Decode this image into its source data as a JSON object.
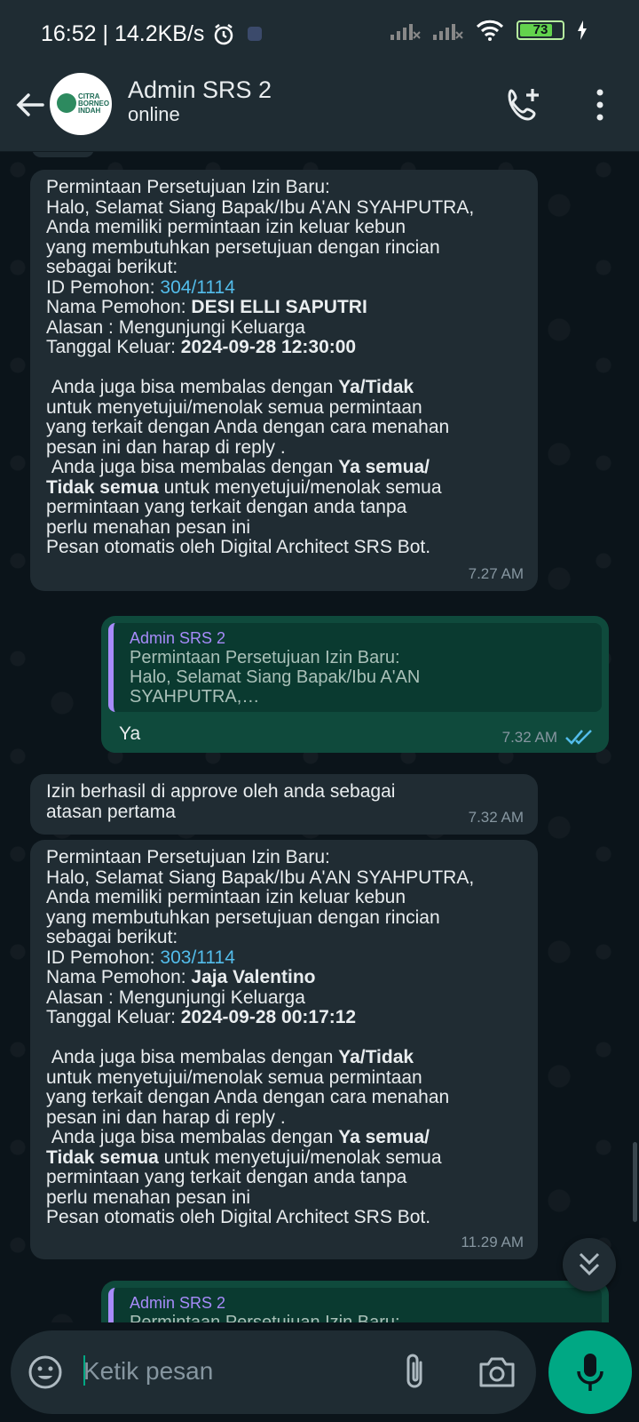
{
  "status_bar": {
    "time_speed": "16:52 | 14.2KB/s",
    "battery": "73"
  },
  "header": {
    "contact_name": "Admin SRS 2",
    "contact_status": "online",
    "avatar_text": [
      "CITRA",
      "BORNEO",
      "INDAH"
    ]
  },
  "messages": [
    {
      "direction": "in",
      "lines": [
        [
          {
            "t": "Permintaan Persetujuan Izin Baru:"
          }
        ],
        [
          {
            "t": "Halo, Selamat Siang Bapak/Ibu A'AN SYAHPUTRA,"
          }
        ],
        [
          {
            "t": "Anda memiliki permintaan izin keluar kebun"
          }
        ],
        [
          {
            "t": "yang membutuhkan persetujuan dengan rincian"
          }
        ],
        [
          {
            "t": "sebagai berikut:"
          }
        ],
        [
          {
            "t": "ID Pemohon: "
          },
          {
            "t": "304/1114",
            "s": "link"
          }
        ],
        [
          {
            "t": "Nama Pemohon: "
          },
          {
            "t": "DESI ELLI SAPUTRI",
            "s": "b"
          }
        ],
        [
          {
            "t": "Alasan : Mengunjungi Keluarga"
          }
        ],
        [
          {
            "t": "Tanggal Keluar: "
          },
          {
            "t": "2024-09-28 12:30:00",
            "s": "b"
          }
        ],
        [
          {
            "t": ""
          }
        ],
        [
          {
            "t": " Anda juga bisa membalas dengan "
          },
          {
            "t": "Ya/Tidak",
            "s": "b"
          }
        ],
        [
          {
            "t": "untuk menyetujui/menolak semua permintaan"
          }
        ],
        [
          {
            "t": "yang terkait dengan Anda dengan cara menahan"
          }
        ],
        [
          {
            "t": "pesan ini dan harap di reply ."
          }
        ],
        [
          {
            "t": " Anda juga bisa membalas dengan "
          },
          {
            "t": "Ya semua/",
            "s": "b"
          }
        ],
        [
          {
            "t": "Tidak semua",
            "s": "b"
          },
          {
            "t": " untuk menyetujui/menolak semua"
          }
        ],
        [
          {
            "t": "permintaan yang terkait dengan anda tanpa"
          }
        ],
        [
          {
            "t": "perlu menahan pesan ini"
          }
        ],
        [
          {
            "t": "Pesan otomatis oleh Digital Architect SRS Bot."
          }
        ]
      ],
      "time": "7.27 AM"
    },
    {
      "direction": "out",
      "quote_author": "Admin SRS 2",
      "quote_lines": [
        "Permintaan Persetujuan Izin Baru:",
        "Halo, Selamat Siang Bapak/Ibu A'AN",
        "SYAHPUTRA,…"
      ],
      "text": "Ya",
      "time": "7.32 AM"
    },
    {
      "direction": "in",
      "lines": [
        [
          {
            "t": "Izin berhasil di approve oleh anda sebagai"
          }
        ],
        [
          {
            "t": "atasan pertama"
          }
        ]
      ],
      "time": "7.32 AM"
    },
    {
      "direction": "in",
      "lines": [
        [
          {
            "t": "Permintaan Persetujuan Izin Baru:"
          }
        ],
        [
          {
            "t": "Halo, Selamat Siang Bapak/Ibu A'AN SYAHPUTRA,"
          }
        ],
        [
          {
            "t": "Anda memiliki permintaan izin keluar kebun"
          }
        ],
        [
          {
            "t": "yang membutuhkan persetujuan dengan rincian"
          }
        ],
        [
          {
            "t": "sebagai berikut:"
          }
        ],
        [
          {
            "t": "ID Pemohon: "
          },
          {
            "t": "303/1114",
            "s": "link"
          }
        ],
        [
          {
            "t": "Nama Pemohon: "
          },
          {
            "t": "Jaja Valentino",
            "s": "b"
          }
        ],
        [
          {
            "t": "Alasan : Mengunjungi Keluarga"
          }
        ],
        [
          {
            "t": "Tanggal Keluar: "
          },
          {
            "t": "2024-09-28 00:17:12",
            "s": "b"
          }
        ],
        [
          {
            "t": ""
          }
        ],
        [
          {
            "t": " Anda juga bisa membalas dengan "
          },
          {
            "t": "Ya/Tidak",
            "s": "b"
          }
        ],
        [
          {
            "t": "untuk menyetujui/menolak semua permintaan"
          }
        ],
        [
          {
            "t": "yang terkait dengan Anda dengan cara menahan"
          }
        ],
        [
          {
            "t": "pesan ini dan harap di reply ."
          }
        ],
        [
          {
            "t": " Anda juga bisa membalas dengan "
          },
          {
            "t": "Ya semua/",
            "s": "b"
          }
        ],
        [
          {
            "t": "Tidak semua",
            "s": "b"
          },
          {
            "t": " untuk menyetujui/menolak semua"
          }
        ],
        [
          {
            "t": "permintaan yang terkait dengan anda tanpa"
          }
        ],
        [
          {
            "t": "perlu menahan pesan ini"
          }
        ],
        [
          {
            "t": "Pesan otomatis oleh Digital Architect SRS Bot."
          }
        ]
      ],
      "time": "11.29 AM"
    },
    {
      "direction": "out",
      "quote_author": "Admin SRS 2",
      "quote_lines": [
        "Permintaan Persetujuan Izin Baru:"
      ],
      "text": "",
      "time": ""
    }
  ],
  "composer": {
    "placeholder": "Ketik pesan"
  },
  "colors": {
    "accent": "#00a884",
    "incoming_bubble": "#202c33",
    "outgoing_bubble": "#0f4a3c",
    "link": "#53bdeb",
    "read_ticks": "#53bdeb",
    "quote_author": "#a78bfa"
  },
  "icons": [
    "back-arrow-icon",
    "add-call-icon",
    "more-vert-icon",
    "alarm-icon",
    "signal-icon",
    "wifi-icon",
    "battery-icon",
    "charging-icon",
    "double-check-icon",
    "chevron-double-down-icon",
    "emoji-icon",
    "attach-icon",
    "camera-icon",
    "mic-icon"
  ]
}
